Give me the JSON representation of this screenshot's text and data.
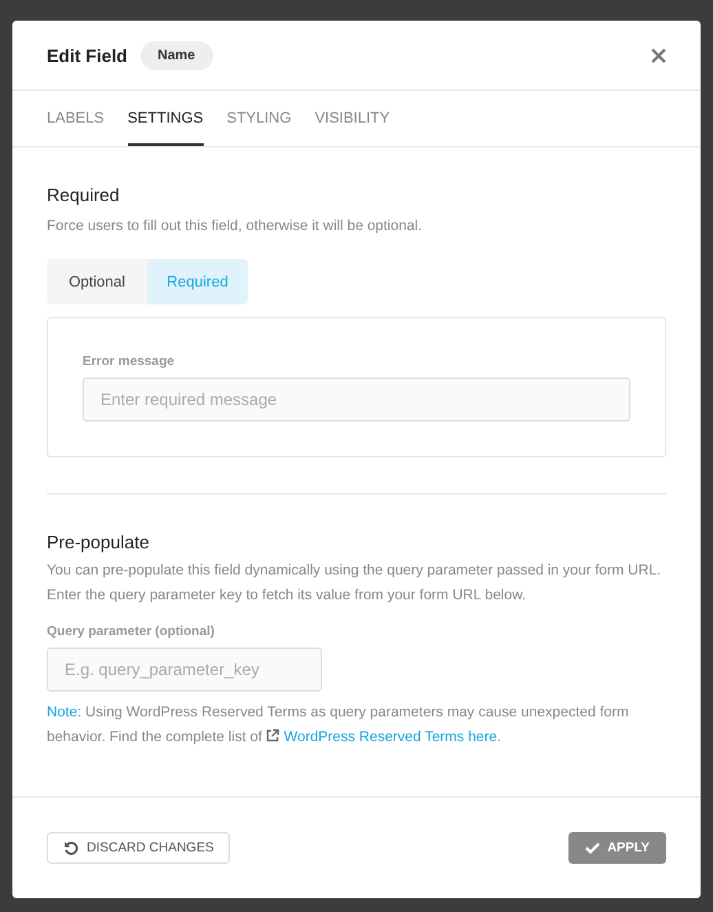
{
  "dialog": {
    "title": "Edit Field",
    "badge": "Name"
  },
  "tabs": [
    {
      "label": "LABELS",
      "selected": false
    },
    {
      "label": "SETTINGS",
      "selected": true
    },
    {
      "label": "STYLING",
      "selected": false
    },
    {
      "label": "VISIBILITY",
      "selected": false
    }
  ],
  "required": {
    "heading": "Required",
    "description": "Force users to fill out this field, otherwise it will be optional.",
    "options": [
      {
        "label": "Optional",
        "selected": false
      },
      {
        "label": "Required",
        "selected": true
      }
    ],
    "error_message": {
      "label": "Error message",
      "placeholder": "Enter required message"
    }
  },
  "prepopulate": {
    "heading": "Pre-populate",
    "description": "You can pre-populate this field dynamically using the query parameter passed in your form URL. Enter the query parameter key to fetch its value from your form URL below.",
    "query_parameter": {
      "label": "Query parameter (optional)",
      "placeholder": "E.g. query_parameter_key"
    },
    "note": {
      "label": "Note:",
      "text": "Using WordPress Reserved Terms as query parameters may cause unexpected form behavior. Find the complete list of",
      "link": "WordPress Reserved Terms here",
      "end": "."
    }
  },
  "footer": {
    "discard": "DISCARD CHANGES",
    "apply": {
      "label": "APPLY",
      "disabled": true
    }
  }
}
